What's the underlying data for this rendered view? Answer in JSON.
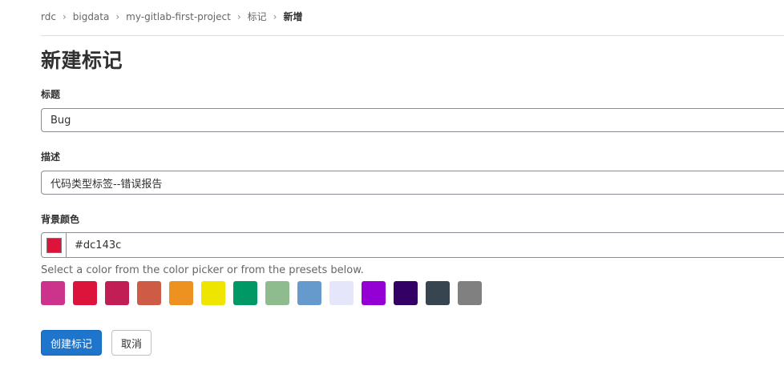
{
  "breadcrumb": {
    "items": [
      "rdc",
      "bigdata",
      "my-gitlab-first-project",
      "标记"
    ],
    "current": "新增"
  },
  "page_title": "新建标记",
  "form": {
    "title_label": "标题",
    "title_value": "Bug",
    "description_label": "描述",
    "description_value": "代码类型标签--错误报告",
    "color_label": "背景颜色",
    "color_value": "#dc143c",
    "color_hint": "Select a color from the color picker or from the presets below."
  },
  "presets": [
    "#cc338b",
    "#dc143c",
    "#c21e56",
    "#cd5b45",
    "#ed9121",
    "#eee600",
    "#009966",
    "#8fbc8f",
    "#6699cc",
    "#e6e6fa",
    "#9400d3",
    "#330066",
    "#36454f",
    "#808080"
  ],
  "actions": {
    "create_label": "创建标记",
    "cancel_label": "取消"
  }
}
